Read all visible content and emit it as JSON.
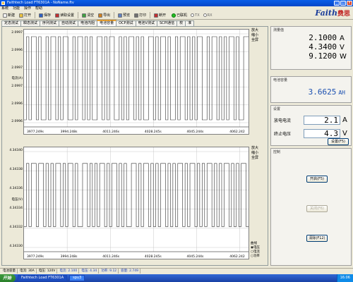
{
  "window": {
    "title": "Faithtech Load FT6301A - NoName.ftv",
    "min_glyph": "_",
    "max_glyph": "□",
    "close_glyph": "x"
  },
  "menu": [
    "系统",
    "功能",
    "操作",
    "帮助"
  ],
  "toolbar": {
    "buttons": [
      {
        "label": "新建",
        "icon": "new-file-icon",
        "color": "#f0f0f0"
      },
      {
        "label": "打开",
        "icon": "open-folder-icon",
        "color": "#e8c040"
      },
      {
        "label": "保存",
        "icon": "save-icon",
        "color": "#3060c0"
      },
      {
        "label": "读取设置",
        "icon": "read-settings-icon",
        "color": "#c03030"
      },
      {
        "label": "清空",
        "icon": "clear-icon",
        "color": "#40a040"
      },
      {
        "label": "导出",
        "icon": "export-icon",
        "color": "#d08020"
      },
      {
        "label": "预览",
        "icon": "preview-icon",
        "color": "#6080c0"
      },
      {
        "label": "打印",
        "icon": "print-icon",
        "color": "#707070"
      },
      {
        "label": "断开",
        "icon": "disconnect-icon",
        "color": "#c03030"
      }
    ],
    "connection_status": "已联机",
    "radio_options": [
      "TX",
      "RX"
    ]
  },
  "brand": {
    "name": "Faith",
    "cn": "费思"
  },
  "tabs": [
    "定态测试",
    "瞬态测试",
    "序列测试",
    "自动测试",
    "电池内阻",
    "电池容量",
    "OCP测试",
    "电池V测试",
    "SCPI通信",
    "校",
    "准"
  ],
  "active_tab": 5,
  "plots": {
    "current": {
      "ylabel": "电流(A)",
      "yticks": [
        "2.0997",
        "2.0996",
        "2.0997",
        "2.0997",
        "2.0996",
        "2.0996"
      ],
      "xticks": [
        "3977.249s",
        "3994.248s",
        "4011.246s",
        "4028.245s",
        "4045.244s",
        "4062.242"
      ],
      "options": [
        "放大",
        "缩小",
        "全屏"
      ],
      "signal": [
        0,
        1,
        0,
        1,
        1,
        0,
        1,
        0,
        0,
        1,
        0,
        1,
        1,
        0,
        1,
        0,
        1,
        1,
        0,
        0,
        1,
        0,
        1,
        1,
        0,
        1,
        0,
        1,
        0,
        0,
        1,
        1,
        0,
        1,
        0,
        1,
        1,
        0,
        0,
        1,
        0,
        1,
        0,
        1,
        1,
        0,
        1,
        0,
        1,
        0,
        0,
        1,
        1,
        0,
        1,
        0,
        1,
        1,
        0,
        1,
        0,
        0,
        1,
        0,
        1,
        1,
        0,
        1,
        0,
        1,
        0,
        1,
        1,
        0,
        0,
        1,
        0,
        1,
        1,
        0,
        1,
        0,
        1,
        0,
        1,
        1,
        0,
        1,
        0,
        0,
        1,
        1
      ]
    },
    "voltage": {
      "ylabel": "电压(V)",
      "yticks": [
        "4.34340",
        "4.34338",
        "4.34336",
        "4.34334",
        "4.34332",
        "4.34330"
      ],
      "xticks": [
        "3977.249s",
        "3994.248s",
        "4011.246s",
        "4028.245s",
        "4045.244s",
        "4062.242"
      ],
      "options": [
        "放大",
        "缩小",
        "全屏"
      ],
      "signal": [
        0.2,
        0.9,
        0.2,
        0.9,
        0.9,
        0.2,
        0.9,
        0.9,
        0.2,
        0.9,
        0.2,
        0.9,
        0.2,
        0.9,
        0.9,
        0.2,
        0.9,
        0.2,
        0.9,
        0.9,
        0.2,
        0.9,
        0.2,
        0.2,
        0.9,
        0.9,
        0.2,
        0.9,
        0.2,
        0.9,
        0.2,
        0.9,
        0.9,
        0.2,
        0.9,
        0.2,
        0.9,
        0.9,
        0.2,
        0.9,
        0.2,
        0.9,
        0.2,
        0.2,
        0.9,
        0.9,
        0.2,
        0.9,
        0.2,
        0.9,
        0.9,
        0.2,
        0.9,
        0.2,
        0.9,
        0.2,
        0.9,
        0.9,
        0.2,
        0.9,
        0.2,
        0.9,
        0.2,
        0.9,
        0.9,
        0.2,
        0.9,
        0.2,
        0.9,
        0.9,
        0.2,
        0.9,
        0.2,
        0.9,
        0.2,
        0.9,
        0.9,
        0.2,
        0.9,
        0.2,
        0.9,
        0.2,
        0.9,
        0.9,
        0.2,
        0.9,
        0.2,
        0.9,
        0.2,
        0.9,
        0.9,
        0.2
      ],
      "curve_label": "曲线",
      "curve_options": [
        "电压",
        "电流",
        "功率"
      ]
    }
  },
  "measure": {
    "title": "测量值",
    "rows": [
      {
        "value": "2.1000",
        "unit": "A"
      },
      {
        "value": "4.3400",
        "unit": "V"
      },
      {
        "value": "9.1200",
        "unit": "W"
      }
    ]
  },
  "capacity": {
    "title": "电池容量",
    "value": "3.6625",
    "unit": "AH"
  },
  "settings": {
    "title": "设置",
    "discharge_label": "放电电流",
    "discharge_value": "2.1",
    "discharge_unit": "A",
    "cutoff_label": "终止电压",
    "cutoff_value": "4.3",
    "cutoff_unit": "V",
    "set_button": "设置(F5)"
  },
  "control": {
    "title": "控制",
    "start_button": "开启(F5)",
    "stop_button": "关闭(F6)",
    "clear_button": "清除(F12)"
  },
  "statusbar": [
    "电池容量",
    "电流: 30A",
    "电压: 120V",
    "电流: 2.100",
    "电压: 4.34",
    "功率: 9.12",
    "容量: 2.749"
  ],
  "taskbar": {
    "start_label": "开始",
    "items": [
      "Faithtech Load FT6301A",
      "spu3"
    ],
    "clock": "16:06"
  }
}
